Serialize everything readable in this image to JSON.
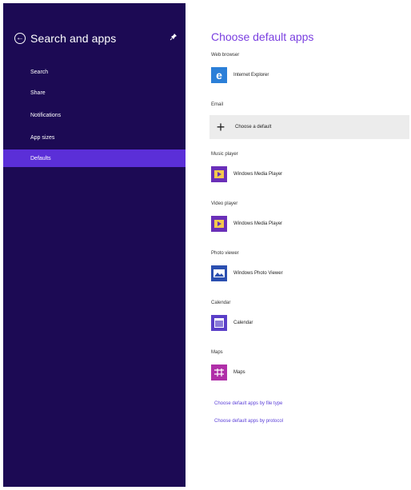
{
  "sidebar": {
    "title": "Search and apps",
    "back_icon": "back-arrow-icon",
    "pin_icon": "pin-icon",
    "items": [
      {
        "label": "Search"
      },
      {
        "label": "Share"
      },
      {
        "label": "Notifications"
      },
      {
        "label": "App sizes"
      },
      {
        "label": "Defaults",
        "active": true
      }
    ]
  },
  "main": {
    "title": "Choose default apps",
    "sections": [
      {
        "label": "Web browser",
        "app": "Internet Explorer",
        "icon": "internet-explorer-icon",
        "color": "#2b7fd8"
      },
      {
        "label": "Email",
        "app": "Choose a default",
        "icon": "plus-icon"
      },
      {
        "label": "Music player",
        "app": "Windows Media Player",
        "icon": "media-player-icon",
        "color": "#6a2fb8"
      },
      {
        "label": "Video player",
        "app": "Windows Media Player",
        "icon": "media-player-icon",
        "color": "#6a2fb8"
      },
      {
        "label": "Photo viewer",
        "app": "Windows Photo Viewer",
        "icon": "photo-viewer-icon",
        "color": "#2b4fb0"
      },
      {
        "label": "Calendar",
        "app": "Calendar",
        "icon": "calendar-icon",
        "color": "#5a3fc8"
      },
      {
        "label": "Maps",
        "app": "Maps",
        "icon": "maps-icon",
        "color": "#b02fa8"
      }
    ],
    "links": [
      "Choose default apps by file type",
      "Choose default apps by protocol"
    ]
  },
  "colors": {
    "sidebar_bg": "#1c0a54",
    "sidebar_active": "#5b2fd8",
    "accent": "#7a3fe0",
    "link": "#5b3fd8"
  }
}
